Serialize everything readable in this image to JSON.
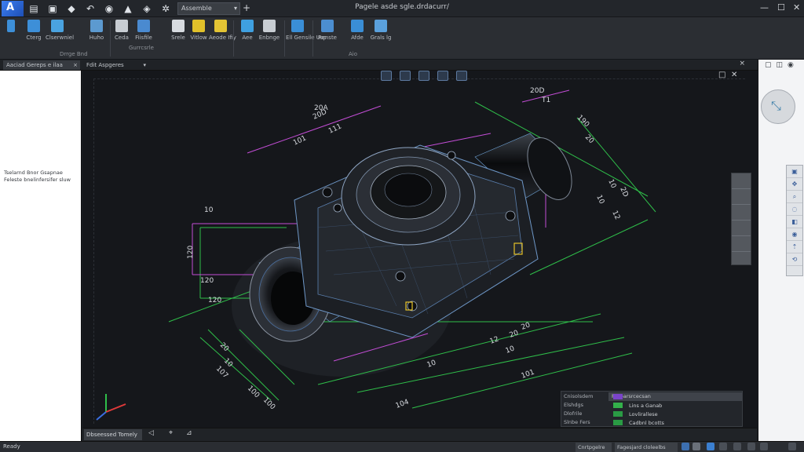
{
  "titlebar": {
    "app_logo": "A",
    "workspace_select": "Assemble",
    "window_title": "Pagele asde sgle.drdacurr/",
    "minimize": "—",
    "maximize": "☐",
    "close": "✕"
  },
  "ribbon": {
    "buttons": [
      {
        "label": "Cterg",
        "color": "#3d8fd8"
      },
      {
        "label": "Clserwniel",
        "color": "#4aa3e0"
      },
      {
        "label": "Huho",
        "color": "#5c9ad0"
      },
      {
        "label": "Ceda",
        "color": "#c8cdd3"
      },
      {
        "label": "Fiisfile",
        "color": "#4a8ad0"
      },
      {
        "label": "Srele",
        "color": "#d7dbe0"
      },
      {
        "label": "Vitlow",
        "color": "#e1c12a"
      },
      {
        "label": "Aeode Ifiy",
        "color": "#e3c434"
      },
      {
        "label": "Aee",
        "color": "#3fa0e0"
      },
      {
        "label": "Enbnge",
        "color": "#c8cdd3"
      },
      {
        "label": "Ell Gensile Usp",
        "color": "#3a8ed6"
      },
      {
        "label": "Renste",
        "color": "#4c8ed0"
      },
      {
        "label": "Afde",
        "color": "#3a8ed6"
      },
      {
        "label": "Grals lg",
        "color": "#5aa0dc"
      }
    ],
    "groups": [
      "Drrge Bnd",
      "Gurrcsrle",
      "Aio"
    ]
  },
  "tabs": {
    "document_tab": "Aaciad Gereps e ilaa",
    "browser_title": "Fdit Aspgeres"
  },
  "browser_panel": {
    "text": "Tselarnd Bnor Gsapnae Feleste bnelinfersifer sluw"
  },
  "canvas": {
    "dims": [
      "20D",
      "20A",
      "20D",
      "111",
      "101",
      "T1",
      "10",
      "120",
      "120",
      "120",
      "190",
      "20",
      "10",
      "10",
      "2D",
      "12",
      "20",
      "20",
      "12",
      "10",
      "10",
      "101",
      "20",
      "10",
      "107",
      "100",
      "100",
      "104"
    ]
  },
  "sheetbar": {
    "sheet_tab": "Dbseessed Tomely"
  },
  "infopanel": {
    "header": "Falloarsrcecsan",
    "rows": [
      {
        "label": "Cnisolsdem",
        "swatch": "#7a44c9",
        "text": ""
      },
      {
        "label": "Elshdgs",
        "swatch": "#33b04a",
        "text": "Lins a Ganab"
      },
      {
        "label": "Dlofrile",
        "swatch": "#2a9b44",
        "text": "Lovlirallese"
      },
      {
        "label": "Slnbe Fers",
        "swatch": "#2a9b44",
        "text": "Cadbnl bcotts"
      }
    ]
  },
  "statusbar": {
    "left_text": "Ready",
    "coords": "Cnrtpgelre",
    "mode": "Fagesjard cloleelbs"
  }
}
